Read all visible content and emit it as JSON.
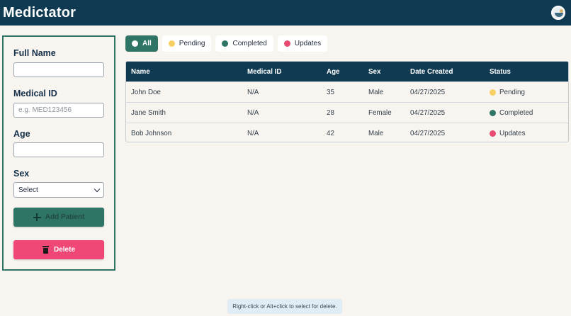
{
  "header": {
    "title": "Medictator",
    "logo_icon": "app-logo-icon"
  },
  "form": {
    "full_name_label": "Full Name",
    "full_name_value": "",
    "medical_id_label": "Medical ID",
    "medical_id_placeholder": "e.g. MED123456",
    "age_label": "Age",
    "age_value": "",
    "sex_label": "Sex",
    "sex_selected": "Select",
    "add_button": "Add Patient",
    "delete_button": "Delete"
  },
  "filters": [
    {
      "label": "All",
      "color": "#ffffff",
      "active": true
    },
    {
      "label": "Pending",
      "color": "#f8cf63",
      "active": false
    },
    {
      "label": "Completed",
      "color": "#2e7566",
      "active": false
    },
    {
      "label": "Updates",
      "color": "#e94a72",
      "active": false
    }
  ],
  "table": {
    "columns": [
      "Name",
      "Medical ID",
      "Age",
      "Sex",
      "Date Created",
      "Status"
    ],
    "rows": [
      {
        "name": "John Doe",
        "medical_id": "N/A",
        "age": "35",
        "sex": "Male",
        "date_created": "04/27/2025",
        "status": "Pending",
        "status_color": "#f8cf63"
      },
      {
        "name": "Jane Smith",
        "medical_id": "N/A",
        "age": "28",
        "sex": "Female",
        "date_created": "04/27/2025",
        "status": "Completed",
        "status_color": "#2e7566"
      },
      {
        "name": "Bob Johnson",
        "medical_id": "N/A",
        "age": "42",
        "sex": "Male",
        "date_created": "04/27/2025",
        "status": "Updates",
        "status_color": "#e94a72"
      }
    ]
  },
  "hint": "Right-click or Alt+click to select for delete.",
  "colors": {
    "primary": "#0f3a52",
    "accent": "#2e7566",
    "danger": "#f04876",
    "background": "#f8f4ef"
  }
}
